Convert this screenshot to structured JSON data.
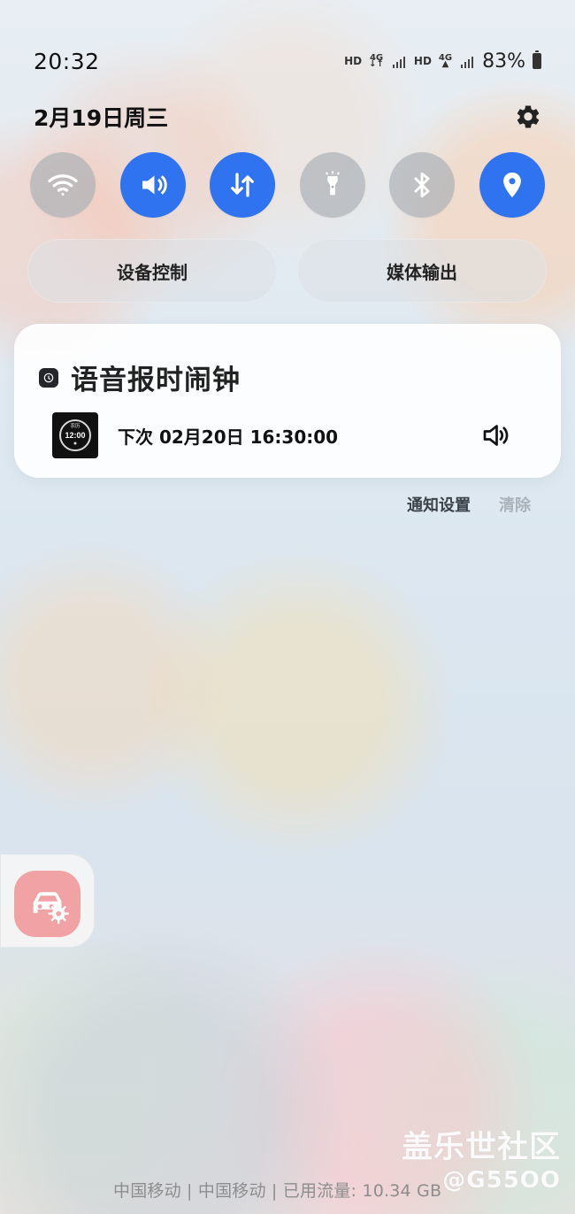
{
  "status_bar": {
    "time": "20:32",
    "hd_1": "HD",
    "network_1": "4G",
    "hd_2": "HD",
    "network_2": "4G",
    "battery": "83%"
  },
  "panel": {
    "date": "2月19日周三",
    "quick_toggles": [
      {
        "name": "wifi",
        "state": "off",
        "icon": "wifi-icon"
      },
      {
        "name": "sound",
        "state": "on",
        "icon": "speaker-icon"
      },
      {
        "name": "mobile-data",
        "state": "on",
        "icon": "data-transfer-icon"
      },
      {
        "name": "flashlight",
        "state": "off",
        "icon": "flashlight-icon"
      },
      {
        "name": "bluetooth",
        "state": "off",
        "icon": "bluetooth-icon"
      },
      {
        "name": "location",
        "state": "on",
        "icon": "location-pin-icon"
      }
    ],
    "device_control_label": "设备控制",
    "media_output_label": "媒体输出"
  },
  "notification": {
    "app_name": "语音报时闹钟",
    "alarm_thumb_label_top": "农历",
    "alarm_thumb_time": "12:00",
    "next_alarm": "下次 02月20日 16:30:00",
    "notification_settings": "通知设置",
    "clear": "清除"
  },
  "watermark": {
    "main": "盖乐世社区",
    "sub": "@G55OO"
  },
  "footer": {
    "carrier_info": "中国移动 | 中国移动 | 已用流量: 10.34 GB"
  },
  "colors": {
    "accent": "#2f73f0",
    "off_toggle": "#aab0b6",
    "car_icon_bg": "#f0a2a5"
  }
}
